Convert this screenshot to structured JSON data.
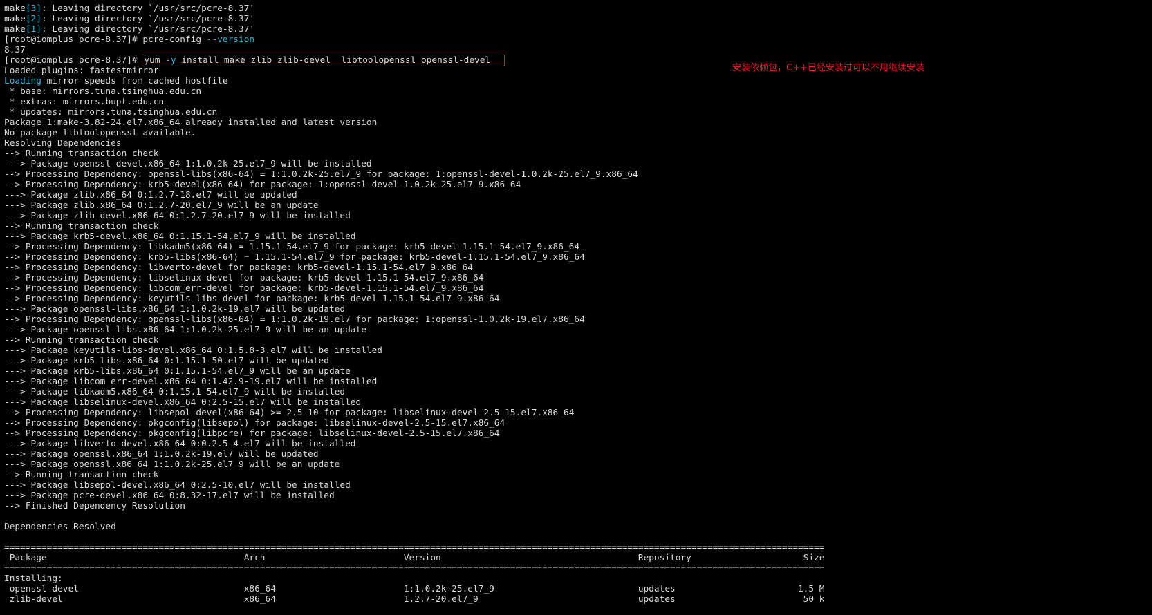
{
  "annotation": "安装依赖包，C++已经安装过可以不用继续安装",
  "colors": {
    "background": "#000000",
    "text": "#d8d8d8",
    "accent": "#2fb7d8",
    "highlight": "#d4202a"
  },
  "lines": [
    [
      {
        "t": "make"
      },
      {
        "t": "[3]",
        "c": "cyan"
      },
      {
        "t": ": Leaving directory `/usr/src/pcre-8.37'"
      }
    ],
    [
      {
        "t": "make"
      },
      {
        "t": "[2]",
        "c": "cyan"
      },
      {
        "t": ": Leaving directory `/usr/src/pcre-8.37'"
      }
    ],
    [
      {
        "t": "make"
      },
      {
        "t": "[1]",
        "c": "cyan"
      },
      {
        "t": ": Leaving directory `/usr/src/pcre-8.37'"
      }
    ],
    [
      {
        "t": "[root@iomplus pcre-8.37]# pcre-config "
      },
      {
        "t": "--version",
        "c": "cyan"
      }
    ],
    [
      {
        "t": "8.37"
      }
    ],
    [
      {
        "t": "[root@iomplus pcre-8.37]# "
      },
      {
        "box": true,
        "parts": [
          {
            "t": "yum "
          },
          {
            "t": "-y",
            "c": "cyan"
          },
          {
            "t": " install make zlib zlib-devel  libtoolopenssl openssl-devel"
          }
        ]
      }
    ],
    [
      {
        "t": "Loaded plugins: fastestmirror"
      }
    ],
    [
      {
        "t": "Loading",
        "c": "cyan"
      },
      {
        "t": " mirror speeds from cached hostfile"
      }
    ],
    [
      {
        "t": " * base: mirrors.tuna.tsinghua.edu.cn"
      }
    ],
    [
      {
        "t": " * extras: mirrors.bupt.edu.cn"
      }
    ],
    [
      {
        "t": " * updates: mirrors.tuna.tsinghua.edu.cn"
      }
    ],
    [
      {
        "t": "Package 1:make-3.82-24.el7.x86_64 already installed and latest version"
      }
    ],
    [
      {
        "t": "No package libtoolopenssl available."
      }
    ],
    [
      {
        "t": "Resolving Dependencies"
      }
    ],
    [
      {
        "t": "--> Running transaction check"
      }
    ],
    [
      {
        "t": "---> Package openssl-devel.x86_64 1:1.0.2k-25.el7_9 will be installed"
      }
    ],
    [
      {
        "t": "--> Processing Dependency: openssl-libs(x86-64) = 1:1.0.2k-25.el7_9 for package: 1:openssl-devel-1.0.2k-25.el7_9.x86_64"
      }
    ],
    [
      {
        "t": "--> Processing Dependency: krb5-devel(x86-64) for package: 1:openssl-devel-1.0.2k-25.el7_9.x86_64"
      }
    ],
    [
      {
        "t": "---> Package zlib.x86_64 0:1.2.7-18.el7 will be updated"
      }
    ],
    [
      {
        "t": "---> Package zlib.x86_64 0:1.2.7-20.el7_9 will be an update"
      }
    ],
    [
      {
        "t": "---> Package zlib-devel.x86_64 0:1.2.7-20.el7_9 will be installed"
      }
    ],
    [
      {
        "t": "--> Running transaction check"
      }
    ],
    [
      {
        "t": "---> Package krb5-devel.x86_64 0:1.15.1-54.el7_9 will be installed"
      }
    ],
    [
      {
        "t": "--> Processing Dependency: libkadm5(x86-64) = 1.15.1-54.el7_9 for package: krb5-devel-1.15.1-54.el7_9.x86_64"
      }
    ],
    [
      {
        "t": "--> Processing Dependency: krb5-libs(x86-64) = 1.15.1-54.el7_9 for package: krb5-devel-1.15.1-54.el7_9.x86_64"
      }
    ],
    [
      {
        "t": "--> Processing Dependency: libverto-devel for package: krb5-devel-1.15.1-54.el7_9.x86_64"
      }
    ],
    [
      {
        "t": "--> Processing Dependency: libselinux-devel for package: krb5-devel-1.15.1-54.el7_9.x86_64"
      }
    ],
    [
      {
        "t": "--> Processing Dependency: libcom_err-devel for package: krb5-devel-1.15.1-54.el7_9.x86_64"
      }
    ],
    [
      {
        "t": "--> Processing Dependency: keyutils-libs-devel for package: krb5-devel-1.15.1-54.el7_9.x86_64"
      }
    ],
    [
      {
        "t": "---> Package openssl-libs.x86_64 1:1.0.2k-19.el7 will be updated"
      }
    ],
    [
      {
        "t": "--> Processing Dependency: openssl-libs(x86-64) = 1:1.0.2k-19.el7 for package: 1:openssl-1.0.2k-19.el7.x86_64"
      }
    ],
    [
      {
        "t": "---> Package openssl-libs.x86_64 1:1.0.2k-25.el7_9 will be an update"
      }
    ],
    [
      {
        "t": "--> Running transaction check"
      }
    ],
    [
      {
        "t": "---> Package keyutils-libs-devel.x86_64 0:1.5.8-3.el7 will be installed"
      }
    ],
    [
      {
        "t": "---> Package krb5-libs.x86_64 0:1.15.1-50.el7 will be updated"
      }
    ],
    [
      {
        "t": "---> Package krb5-libs.x86_64 0:1.15.1-54.el7_9 will be an update"
      }
    ],
    [
      {
        "t": "---> Package libcom_err-devel.x86_64 0:1.42.9-19.el7 will be installed"
      }
    ],
    [
      {
        "t": "---> Package libkadm5.x86_64 0:1.15.1-54.el7_9 will be installed"
      }
    ],
    [
      {
        "t": "---> Package libselinux-devel.x86_64 0:2.5-15.el7 will be installed"
      }
    ],
    [
      {
        "t": "--> Processing Dependency: libsepol-devel(x86-64) >= 2.5-10 for package: libselinux-devel-2.5-15.el7.x86_64"
      }
    ],
    [
      {
        "t": "--> Processing Dependency: pkgconfig(libsepol) for package: libselinux-devel-2.5-15.el7.x86_64"
      }
    ],
    [
      {
        "t": "--> Processing Dependency: pkgconfig(libpcre) for package: libselinux-devel-2.5-15.el7.x86_64"
      }
    ],
    [
      {
        "t": "---> Package libverto-devel.x86_64 0:0.2.5-4.el7 will be installed"
      }
    ],
    [
      {
        "t": "---> Package openssl.x86_64 1:1.0.2k-19.el7 will be updated"
      }
    ],
    [
      {
        "t": "---> Package openssl.x86_64 1:1.0.2k-25.el7_9 will be an update"
      }
    ],
    [
      {
        "t": "--> Running transaction check"
      }
    ],
    [
      {
        "t": "---> Package libsepol-devel.x86_64 0:2.5-10.el7 will be installed"
      }
    ],
    [
      {
        "t": "---> Package pcre-devel.x86_64 0:8.32-17.el7 will be installed"
      }
    ],
    [
      {
        "t": "--> Finished Dependency Resolution"
      }
    ],
    [
      {
        "t": ""
      }
    ],
    [
      {
        "t": "Dependencies Resolved"
      }
    ],
    [
      {
        "t": ""
      }
    ],
    [
      {
        "t": "=========================================================================================================================================================="
      }
    ],
    [
      {
        "t": " Package                                     Arch                          Version                                     Repository                     Size"
      }
    ],
    [
      {
        "t": "=========================================================================================================================================================="
      }
    ],
    [
      {
        "t": "Installing:"
      }
    ],
    [
      {
        "t": " openssl-devel                               x86_64                        1:1.0.2k-25.el7_9                           updates                       1.5 M"
      }
    ],
    [
      {
        "t": " zlib-devel                                  x86_64                        1.2.7-20.el7_9                              updates                        50 k"
      }
    ]
  ]
}
